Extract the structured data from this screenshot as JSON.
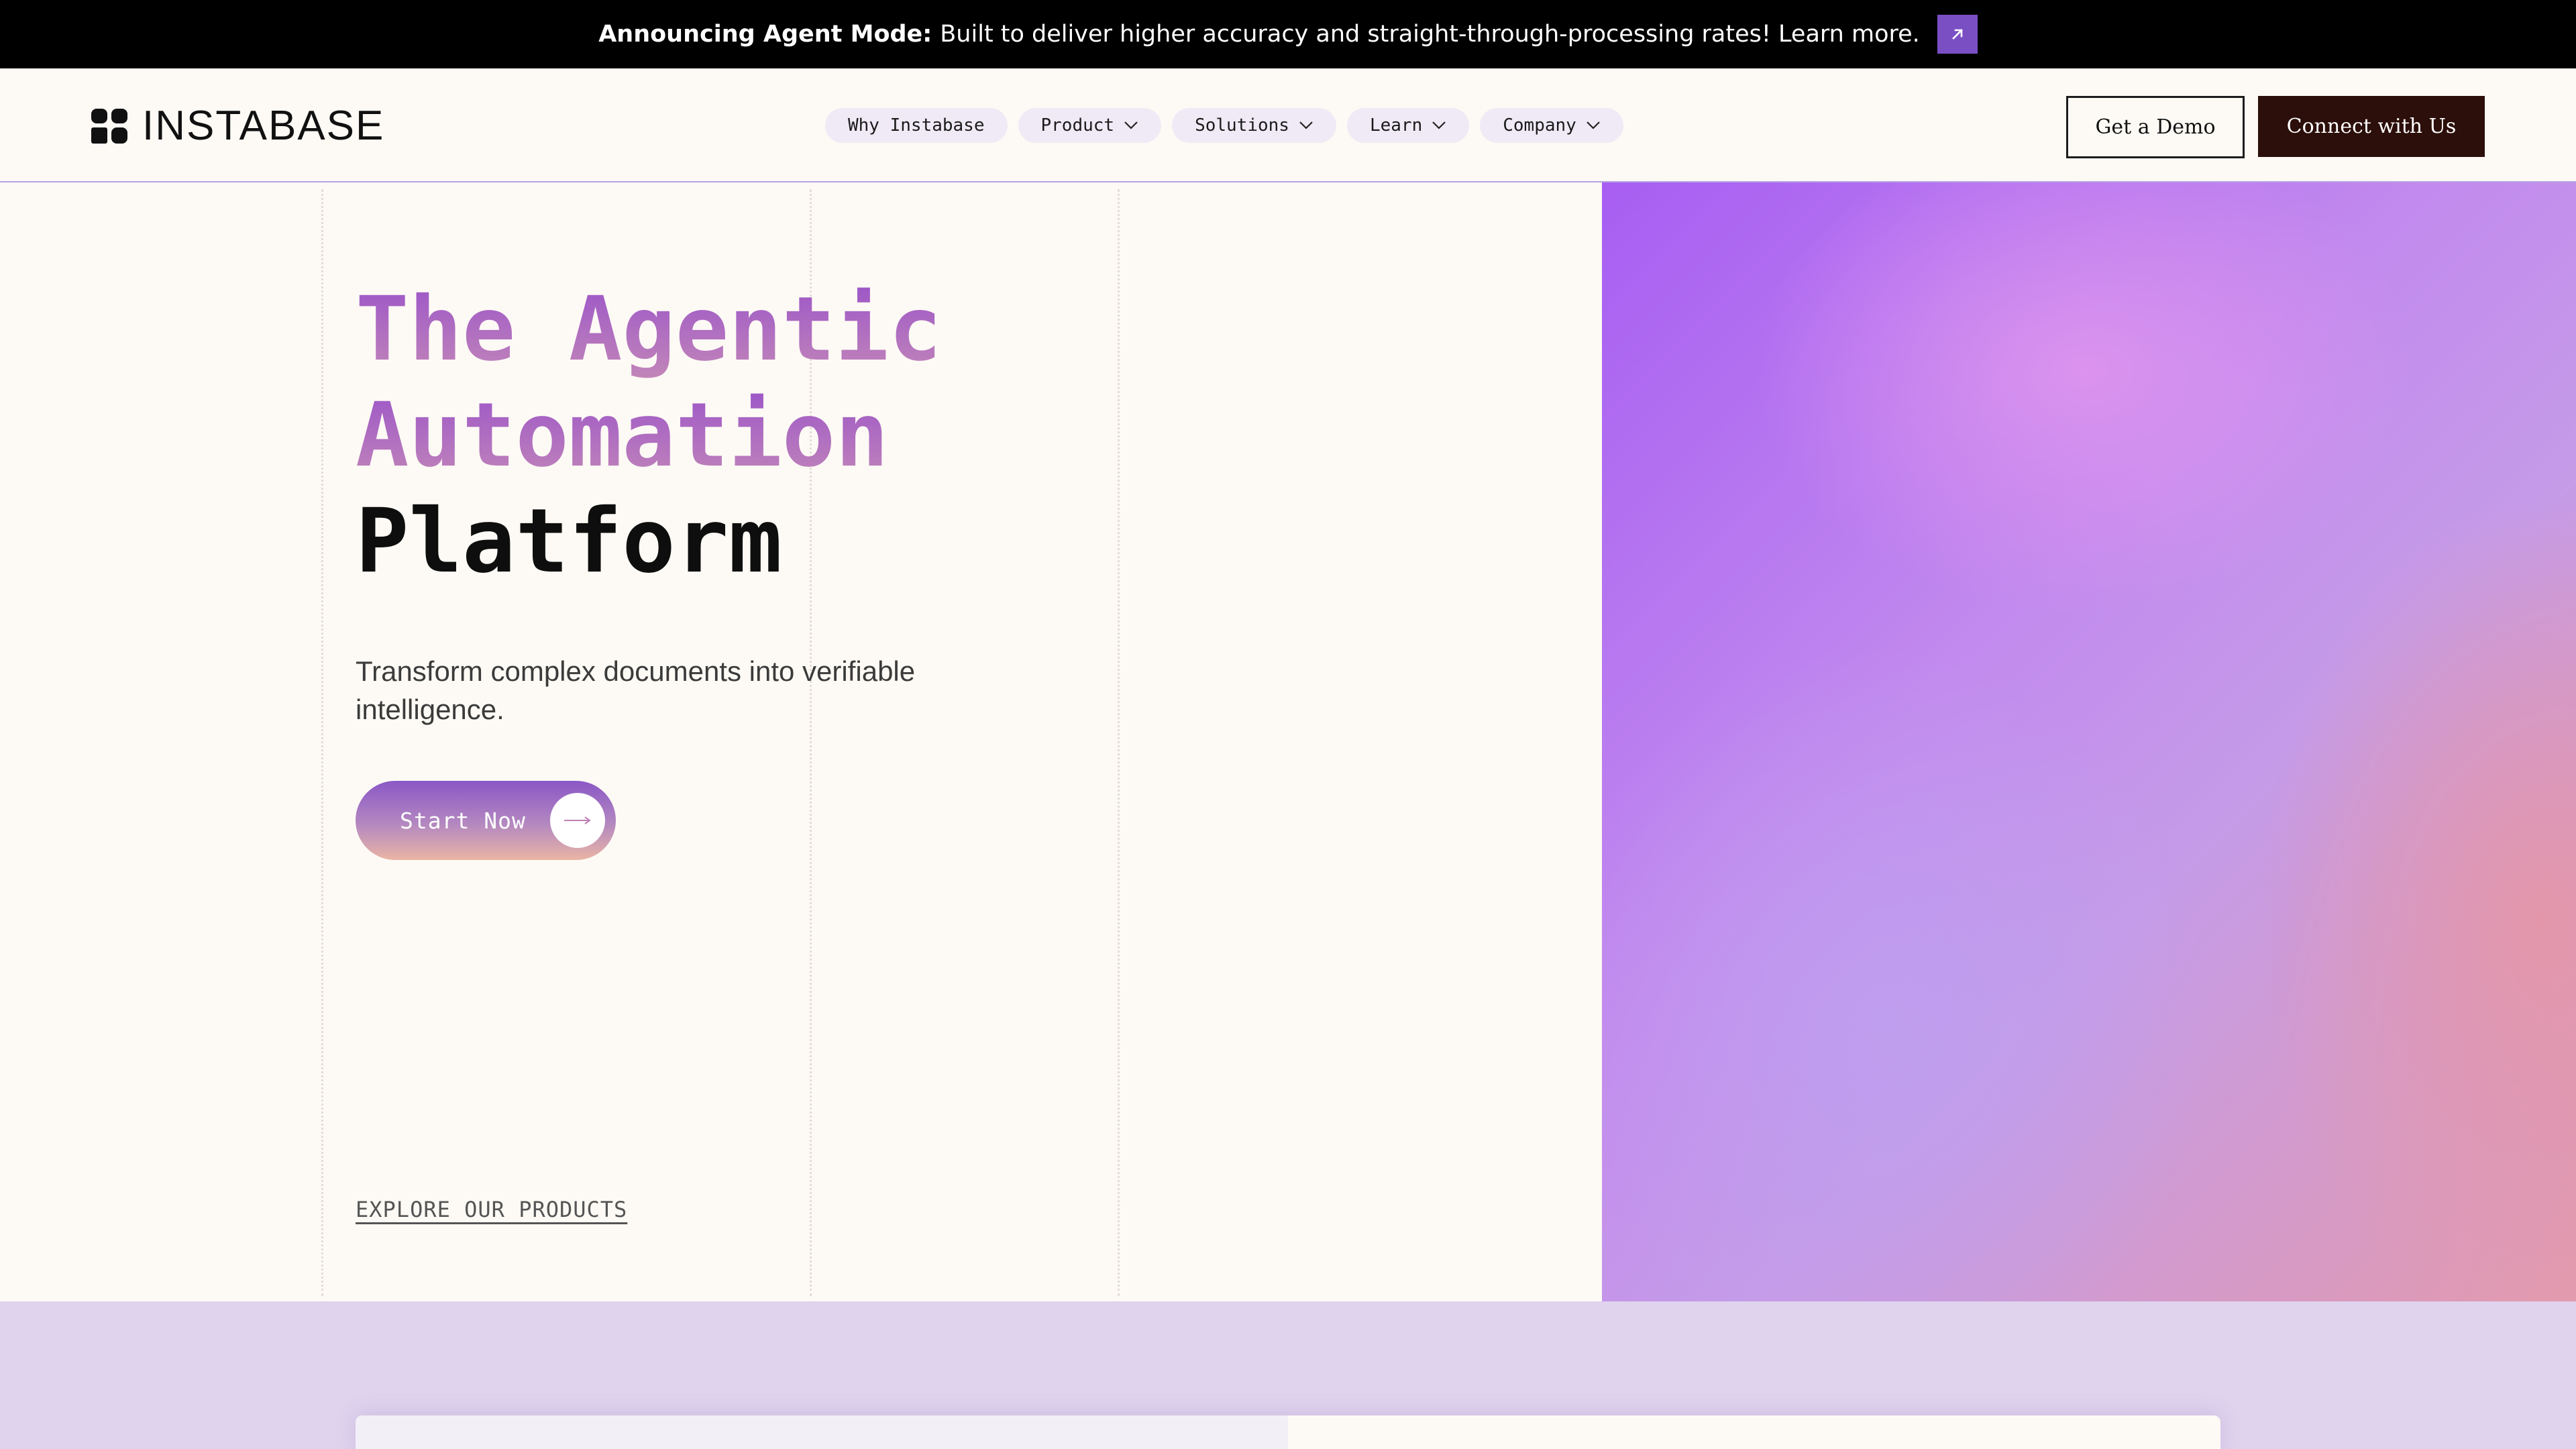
{
  "announcement": {
    "bold_text": "Announcing Agent Mode:",
    "text": "Built to deliver higher accuracy and straight-through-processing rates! Learn more.",
    "icon": "arrow-up-right-icon",
    "accent_color": "#7b4fc4"
  },
  "header": {
    "logo_text": "INSTABASE",
    "nav": [
      {
        "label": "Why Instabase",
        "has_dropdown": false
      },
      {
        "label": "Product",
        "has_dropdown": true
      },
      {
        "label": "Solutions",
        "has_dropdown": true
      },
      {
        "label": "Learn",
        "has_dropdown": true
      },
      {
        "label": "Company",
        "has_dropdown": true
      }
    ],
    "demo_label": "Get a Demo",
    "connect_label": "Connect with Us",
    "connect_color": "#2c0f0a"
  },
  "hero": {
    "title_line1": "The Agentic",
    "title_line2": "Automation",
    "title_line3": "Platform",
    "subtitle": "Transform complex documents into verifiable intelligence.",
    "cta_label": "Start Now",
    "cta_icon": "arrow-right-icon",
    "explore_label": "EXPLORE OUR PRODUCTS"
  }
}
